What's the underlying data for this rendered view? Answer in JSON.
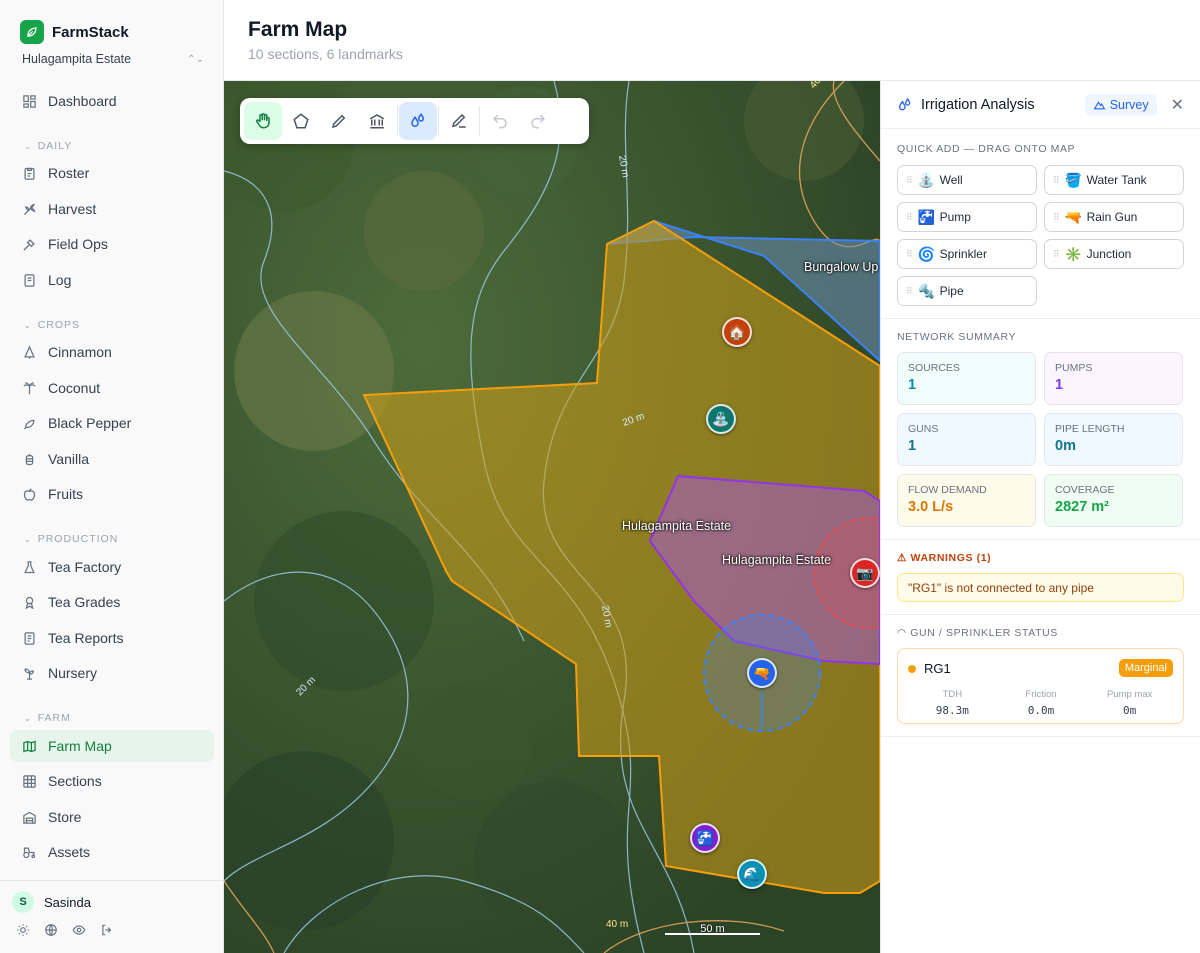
{
  "app": {
    "name": "FarmStack",
    "estate": "Hulagampita Estate"
  },
  "sidebar": {
    "dashboard": "Dashboard",
    "sections": {
      "daily": "DAILY",
      "crops": "CROPS",
      "production": "PRODUCTION",
      "farm": "FARM"
    },
    "daily": [
      "Roster",
      "Harvest",
      "Field Ops",
      "Log"
    ],
    "crops": [
      "Cinnamon",
      "Coconut",
      "Black Pepper",
      "Vanilla",
      "Fruits"
    ],
    "production": [
      "Tea Factory",
      "Tea Grades",
      "Tea Reports",
      "Nursery"
    ],
    "farm": [
      "Farm Map",
      "Sections",
      "Store",
      "Assets"
    ],
    "active": "Farm Map",
    "user": {
      "initial": "S",
      "name": "Sasinda"
    }
  },
  "header": {
    "title": "Farm Map",
    "subtitle": "10 sections, 6 landmarks"
  },
  "map": {
    "labels": {
      "bungalow": "Bungalow Up",
      "estate_1": "Hulagampita Estate",
      "estate_2": "Hulagampita Estate"
    },
    "contours": {
      "c20a": "20 m",
      "c20b": "20 m",
      "c20c": "20 m",
      "c20d": "20 m",
      "c40a": "40 m",
      "c40b": "40 m"
    },
    "scale": "50 m",
    "polygon_colors": {
      "estate": "#f59e0b",
      "bungalow": "#3b82f6",
      "purple": "#a855f7",
      "coverage": "#3b82f6"
    },
    "markers": {
      "house": "🏠",
      "well": "⛲",
      "gun": "🔫",
      "tank": "🪣",
      "pump": "🚰",
      "wave": "🌊",
      "camera": "📷"
    }
  },
  "panel": {
    "title": "Irrigation Analysis",
    "survey": "Survey",
    "quick_add": {
      "title": "QUICK ADD — DRAG ONTO MAP",
      "items": [
        {
          "icon": "⛲",
          "label": "Well"
        },
        {
          "icon": "🪣",
          "label": "Water Tank"
        },
        {
          "icon": "🚰",
          "label": "Pump"
        },
        {
          "icon": "🔫",
          "label": "Rain Gun"
        },
        {
          "icon": "🌀",
          "label": "Sprinkler"
        },
        {
          "icon": "✳️",
          "label": "Junction"
        },
        {
          "icon": "🔩",
          "label": "Pipe"
        }
      ]
    },
    "summary": {
      "title": "NETWORK SUMMARY",
      "stats": [
        {
          "label": "SOURCES",
          "value": "1",
          "color": "#0891b2",
          "bg": "#f0fdfa"
        },
        {
          "label": "PUMPS",
          "value": "1",
          "color": "#7c3aed",
          "bg": "#faf5ff"
        },
        {
          "label": "GUNS",
          "value": "1",
          "color": "#0e7490",
          "bg": "#f0f9ff"
        },
        {
          "label": "PIPE LENGTH",
          "value": "0m",
          "color": "#0e7490",
          "bg": "#f0f9ff"
        },
        {
          "label": "FLOW DEMAND",
          "value": "3.0 L/s",
          "color": "#d97706",
          "bg": "#fffbeb"
        },
        {
          "label": "COVERAGE",
          "value": "2827 m²",
          "color": "#16a34a",
          "bg": "#f0fdf4"
        }
      ]
    },
    "warnings": {
      "title": "WARNINGS (1)",
      "items": [
        "\"RG1\" is not connected to any pipe"
      ]
    },
    "gun_status": {
      "title": "GUN / SPRINKLER STATUS",
      "name": "RG1",
      "badge": "Marginal",
      "cols": [
        {
          "label": "TDH",
          "value": "98.3m"
        },
        {
          "label": "Friction",
          "value": "0.0m"
        },
        {
          "label": "Pump max",
          "value": "0m"
        }
      ]
    }
  }
}
